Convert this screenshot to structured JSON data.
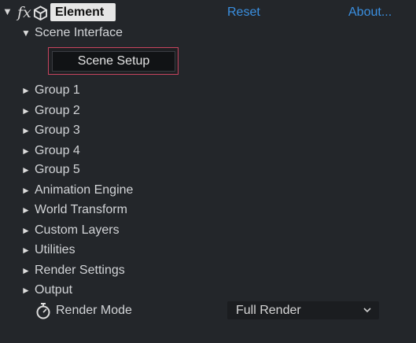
{
  "header": {
    "twirl_glyph": "▼",
    "fx_label": "fx",
    "effect_name": "Element",
    "reset_label": "Reset",
    "about_label": "About..."
  },
  "scene_interface": {
    "twirl_glyph": "▼",
    "label": "Scene Interface",
    "button_label": "Scene Setup"
  },
  "groups": [
    {
      "twirl_glyph": "►",
      "label": "Group 1"
    },
    {
      "twirl_glyph": "►",
      "label": "Group 2"
    },
    {
      "twirl_glyph": "►",
      "label": "Group 3"
    },
    {
      "twirl_glyph": "►",
      "label": "Group 4"
    },
    {
      "twirl_glyph": "►",
      "label": "Group 5"
    },
    {
      "twirl_glyph": "►",
      "label": "Animation Engine"
    },
    {
      "twirl_glyph": "►",
      "label": "World Transform"
    },
    {
      "twirl_glyph": "►",
      "label": "Custom Layers"
    },
    {
      "twirl_glyph": "►",
      "label": "Utilities"
    },
    {
      "twirl_glyph": "►",
      "label": "Render Settings"
    },
    {
      "twirl_glyph": "►",
      "label": "Output"
    }
  ],
  "render_mode": {
    "label": "Render Mode",
    "value": "Full Render"
  },
  "colors": {
    "background": "#23262a",
    "link": "#3a8fe0",
    "focus_border": "#c7445f"
  },
  "icons": {
    "fx": "fx-icon",
    "cube": "cube-icon",
    "stopwatch": "stopwatch-icon",
    "dropdown": "chevron-down-icon"
  }
}
